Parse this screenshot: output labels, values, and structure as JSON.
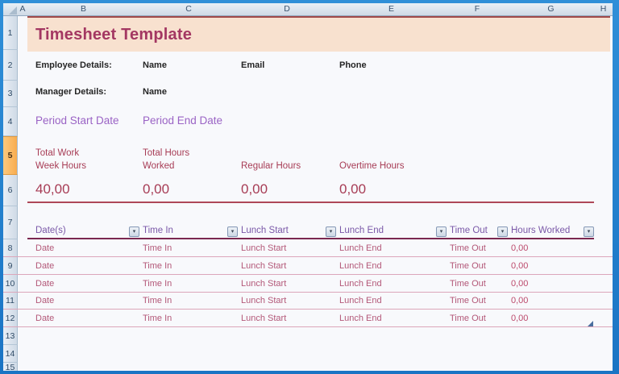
{
  "sheet": {
    "column_headers": [
      "A",
      "B",
      "C",
      "D",
      "E",
      "F",
      "G",
      "H"
    ],
    "row_headers": [
      "1",
      "2",
      "3",
      "4",
      "5",
      "6",
      "7",
      "8",
      "9",
      "10",
      "11",
      "12",
      "13",
      "14",
      "15"
    ],
    "selected_row_header": "5"
  },
  "title": {
    "text": "Timesheet Template"
  },
  "employee": {
    "label": "Employee Details:",
    "name": "Name",
    "email": "Email",
    "phone": "Phone"
  },
  "manager": {
    "label": "Manager Details:",
    "name": "Name"
  },
  "period": {
    "start": "Period Start Date",
    "end": "Period End Date"
  },
  "summary": {
    "total_work_week_hours_label": "Total Work Week Hours",
    "total_hours_worked_label": "Total Hours Worked",
    "regular_hours_label": "Regular Hours",
    "overtime_hours_label": "Overtime Hours",
    "total_work_week_hours": "40,00",
    "total_hours_worked": "0,00",
    "regular_hours": "0,00",
    "overtime_hours": "0,00"
  },
  "table": {
    "headers": [
      "Date(s)",
      "Time In",
      "Lunch Start",
      "Lunch End",
      "Time Out",
      "Hours Worked"
    ],
    "rows": [
      [
        "Date",
        "Time In",
        "Lunch Start",
        "Lunch End",
        "Time Out",
        "0,00"
      ],
      [
        "Date",
        "Time In",
        "Lunch Start",
        "Lunch End",
        "Time Out",
        "0,00"
      ],
      [
        "Date",
        "Time In",
        "Lunch Start",
        "Lunch End",
        "Time Out",
        "0,00"
      ],
      [
        "Date",
        "Time In",
        "Lunch Start",
        "Lunch End",
        "Time Out",
        "0,00"
      ],
      [
        "Date",
        "Time In",
        "Lunch Start",
        "Lunch End",
        "Time Out",
        "0,00"
      ]
    ]
  },
  "icons": {
    "filter_dropdown": "▾"
  },
  "colors": {
    "frame_blue": "#1e80ce",
    "title_background": "#f8e1cf",
    "title_text": "#a33762",
    "title_top_border": "#a04a4a",
    "period_purple": "#9a63c5",
    "summary_raspberry": "#a73c55",
    "table_header_purple": "#7a58a8",
    "table_header_border": "#7a2850",
    "row_separator_pink": "#dca6ba",
    "data_text_pink": "#b35878",
    "selected_row_orange": "#f8ac4e"
  }
}
